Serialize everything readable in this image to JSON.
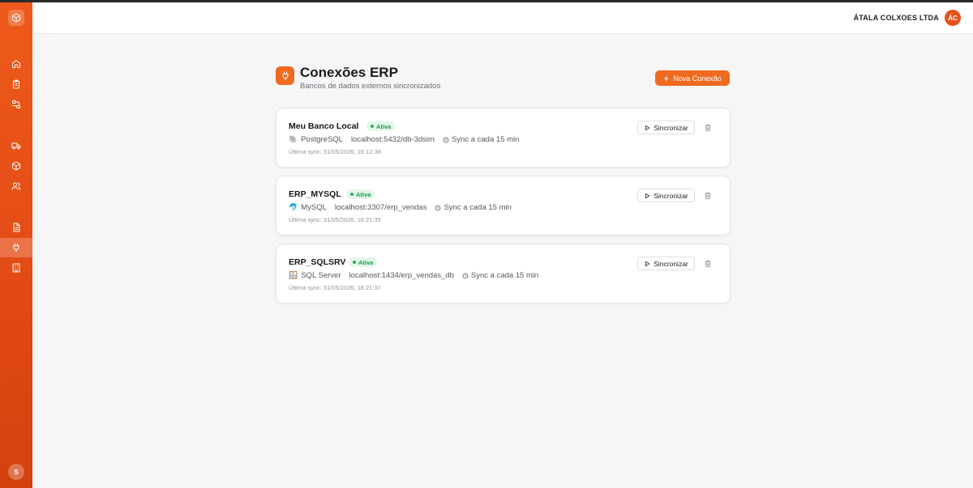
{
  "sidebar": {
    "logo_icon": "box-icon",
    "items": [
      {
        "name": "home",
        "icon": "home-icon"
      },
      {
        "name": "clipboard",
        "icon": "clipboard-icon"
      },
      {
        "name": "workflow",
        "icon": "workflow-icon"
      },
      {
        "name": "truck",
        "icon": "truck-icon"
      },
      {
        "name": "package",
        "icon": "package-icon"
      },
      {
        "name": "users",
        "icon": "users-icon"
      },
      {
        "name": "document",
        "icon": "document-icon"
      },
      {
        "name": "connections",
        "icon": "plug-icon",
        "active": true
      },
      {
        "name": "building",
        "icon": "building-icon"
      }
    ],
    "avatar_initial": "S"
  },
  "header": {
    "company": "ÁTALA COLXOES LTDA",
    "avatar_initials": "ÁC"
  },
  "page": {
    "icon": "plug-icon",
    "title": "Conexões ERP",
    "subtitle": "Bancos de dados externos sincronizados",
    "new_button": "Nova Conexão"
  },
  "connections": [
    {
      "name": "Meu Banco Local",
      "status": "Ativa",
      "db_icon": "🐘",
      "db_type": "PostgreSQL",
      "host": "localhost:5432/db-3dsim",
      "sync_interval": "Sync a cada 15 min",
      "last_sync": "Última sync: 31/05/2026, 16:12:38",
      "sync_button": "Sincronizar"
    },
    {
      "name": "ERP_MYSQL",
      "status": "Ativa",
      "db_icon": "🐬",
      "db_type": "MySQL",
      "host": "localhost:3307/erp_vendas",
      "sync_interval": "Sync a cada 15 min",
      "last_sync": "Última sync: 31/05/2026, 16:21:35",
      "sync_button": "Sincronizar"
    },
    {
      "name": "ERP_SQLSRV",
      "status": "Ativa",
      "db_icon": "🪟",
      "db_type": "SQL Server",
      "host": "localhost:1434/erp_vendas_db",
      "sync_interval": "Sync a cada 15 min",
      "last_sync": "Última sync: 31/05/2026, 16:21:37",
      "sync_button": "Sincronizar"
    }
  ],
  "colors": {
    "accent": "#f06a1f",
    "status_active": "#1f9a4a"
  }
}
